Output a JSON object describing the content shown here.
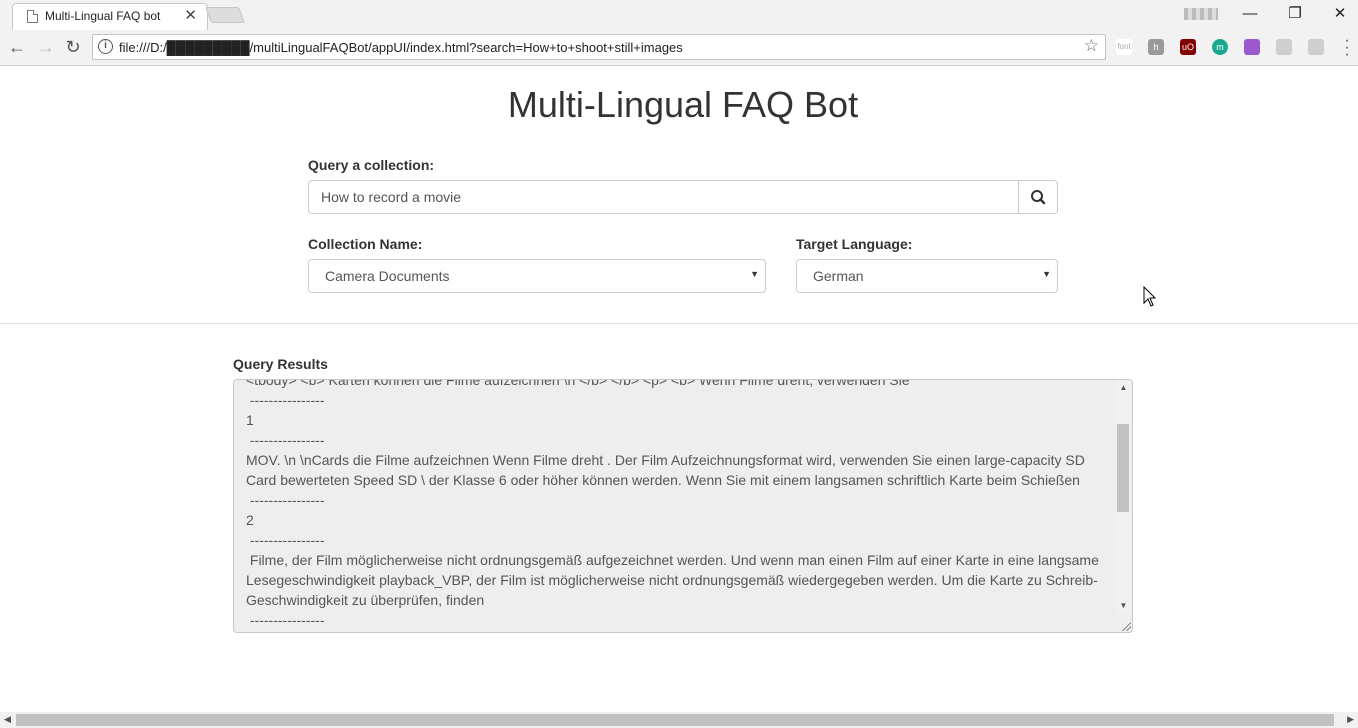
{
  "browser": {
    "tab_title": "Multi-Lingual FAQ bot",
    "url": "file:///D:/█████████/multiLingualFAQBot/appUI/index.html?search=How+to+shoot+still+images",
    "extensions": [
      {
        "name": "font-extension",
        "label": "font",
        "color": "#ffffff"
      },
      {
        "name": "h-extension",
        "label": "h",
        "color": "#9a9a9a"
      },
      {
        "name": "ublock-extension",
        "label": "uO",
        "color": "#800000"
      },
      {
        "name": "m-extension",
        "label": "m",
        "color": "#1aa88f"
      },
      {
        "name": "feather-extension",
        "label": "",
        "color": "#9b59d0"
      },
      {
        "name": "pdf-extension",
        "label": "",
        "color": "#cfcfcf"
      },
      {
        "name": "cast-extension",
        "label": "",
        "color": "#cfcfcf"
      }
    ]
  },
  "page": {
    "title": "Multi-Lingual FAQ Bot",
    "query_label": "Query a collection:",
    "query_value": "How to record a movie",
    "collection_label": "Collection Name:",
    "collection_value": "Camera Documents",
    "language_label": "Target Language:",
    "language_value": "German",
    "results_label": "Query Results",
    "results_text": "<tbody> <b> Karten können die Filme aufzeichnen \\n </b> </b> <p> <b> Wenn Filme dreht, verwenden Sie\n ----------------\n1\n ----------------\nMOV. \\n \\nCards die Filme aufzeichnen Wenn Filme dreht . Der Film Aufzeichnungsformat wird, verwenden Sie einen large-capacity SD Card bewerteten Speed SD \\ der Klasse 6 oder höher können werden. Wenn Sie mit einem langsamen schriftlich Karte beim Schießen\n ----------------\n2\n ----------------\n Filme, der Film möglicherweise nicht ordnungsgemäß aufgezeichnet werden. Und wenn man einen Film auf einer Karte in eine langsame Lesegeschwindigkeit playback_VBP, der Film ist möglicherweise nicht ordnungsgemäß wiedergegeben werden. Um die Karte zu Schreib-Geschwindigkeit zu überprüfen, finden\n ----------------"
  },
  "colors": {
    "accent": "#333333",
    "results_bg": "#eeeeee"
  }
}
